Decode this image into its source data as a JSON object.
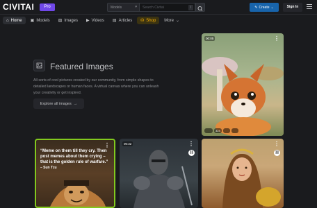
{
  "header": {
    "logo": "CIVITAI",
    "pro_badge": "Pro",
    "search_select": "Models",
    "search_placeholder": "Search Civitai",
    "search_shortcut": "/",
    "create_label": "Create",
    "signin_label": "Sign In"
  },
  "nav": {
    "items": [
      {
        "label": "Home",
        "icon": "home-icon"
      },
      {
        "label": "Models",
        "icon": "box-icon"
      },
      {
        "label": "Images",
        "icon": "image-icon"
      },
      {
        "label": "Videos",
        "icon": "video-icon"
      },
      {
        "label": "Articles",
        "icon": "article-icon"
      },
      {
        "label": "Shop",
        "icon": "shop-icon"
      },
      {
        "label": "More",
        "icon": "chevron-down-icon"
      }
    ]
  },
  "featured": {
    "title": "Featured Images",
    "description": "All sorts of cool pictures created by our community, from simple shapes to detailed landscapes or human faces. A virtual canvas where you can unleash your creativity or get inspired.",
    "explore_label": "Explore all images"
  },
  "cards": {
    "fox": {
      "time": "00:05",
      "stats": [
        "",
        "324",
        "",
        ""
      ]
    },
    "meme": {
      "quote": "“Meme on them till they cry. Then post memes about them crying – that is the golden rule of warfare.”",
      "author": "– Sun Tzu"
    },
    "knight": {
      "time": "00:32"
    }
  },
  "colors": {
    "accent": "#1864ab",
    "pro": "#7048e8",
    "shop": "#fab005",
    "meme_border": "#82c91e"
  }
}
